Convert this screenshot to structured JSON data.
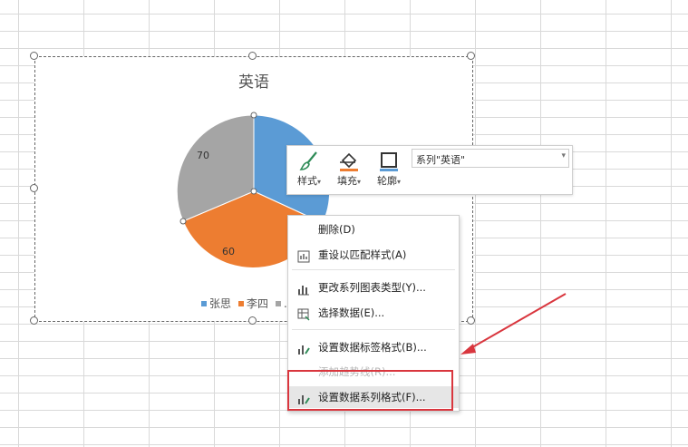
{
  "chart": {
    "title": "英语",
    "legend": [
      {
        "label": "张思",
        "color": "#5b9bd5"
      },
      {
        "label": "李四",
        "color": "#ed7d31"
      },
      {
        "label": "...",
        "color": "#a5a5a5"
      }
    ],
    "slices": [
      {
        "value": 80,
        "color": "#5b9bd5",
        "label": ""
      },
      {
        "value": 60,
        "color": "#ed7d31",
        "label": "60"
      },
      {
        "value": 70,
        "color": "#a5a5a5",
        "label": "70"
      }
    ]
  },
  "toolbar": {
    "style_label": "样式",
    "fill_label": "填充",
    "outline_label": "轮廓",
    "series_value": "系列\"英语\"",
    "caret": "▾"
  },
  "menu": {
    "items": [
      {
        "label": "删除(D)",
        "icon": "none",
        "state": "normal"
      },
      {
        "label": "重设以匹配样式(A)",
        "icon": "reset-style-icon",
        "state": "normal"
      },
      {
        "label": "更改系列图表类型(Y)...",
        "icon": "chart-type-icon",
        "state": "normal"
      },
      {
        "label": "选择数据(E)...",
        "icon": "select-data-icon",
        "state": "normal"
      },
      {
        "label": "设置数据标签格式(B)...",
        "icon": "format-label-icon",
        "state": "normal"
      },
      {
        "label": "添加趋势线(R)...",
        "icon": "none",
        "state": "disabled"
      },
      {
        "label": "设置数据系列格式(F)...",
        "icon": "format-series-icon",
        "state": "hover"
      }
    ]
  },
  "colors": {
    "accent_red": "#d9363e",
    "grid": "#d9d9d9"
  }
}
